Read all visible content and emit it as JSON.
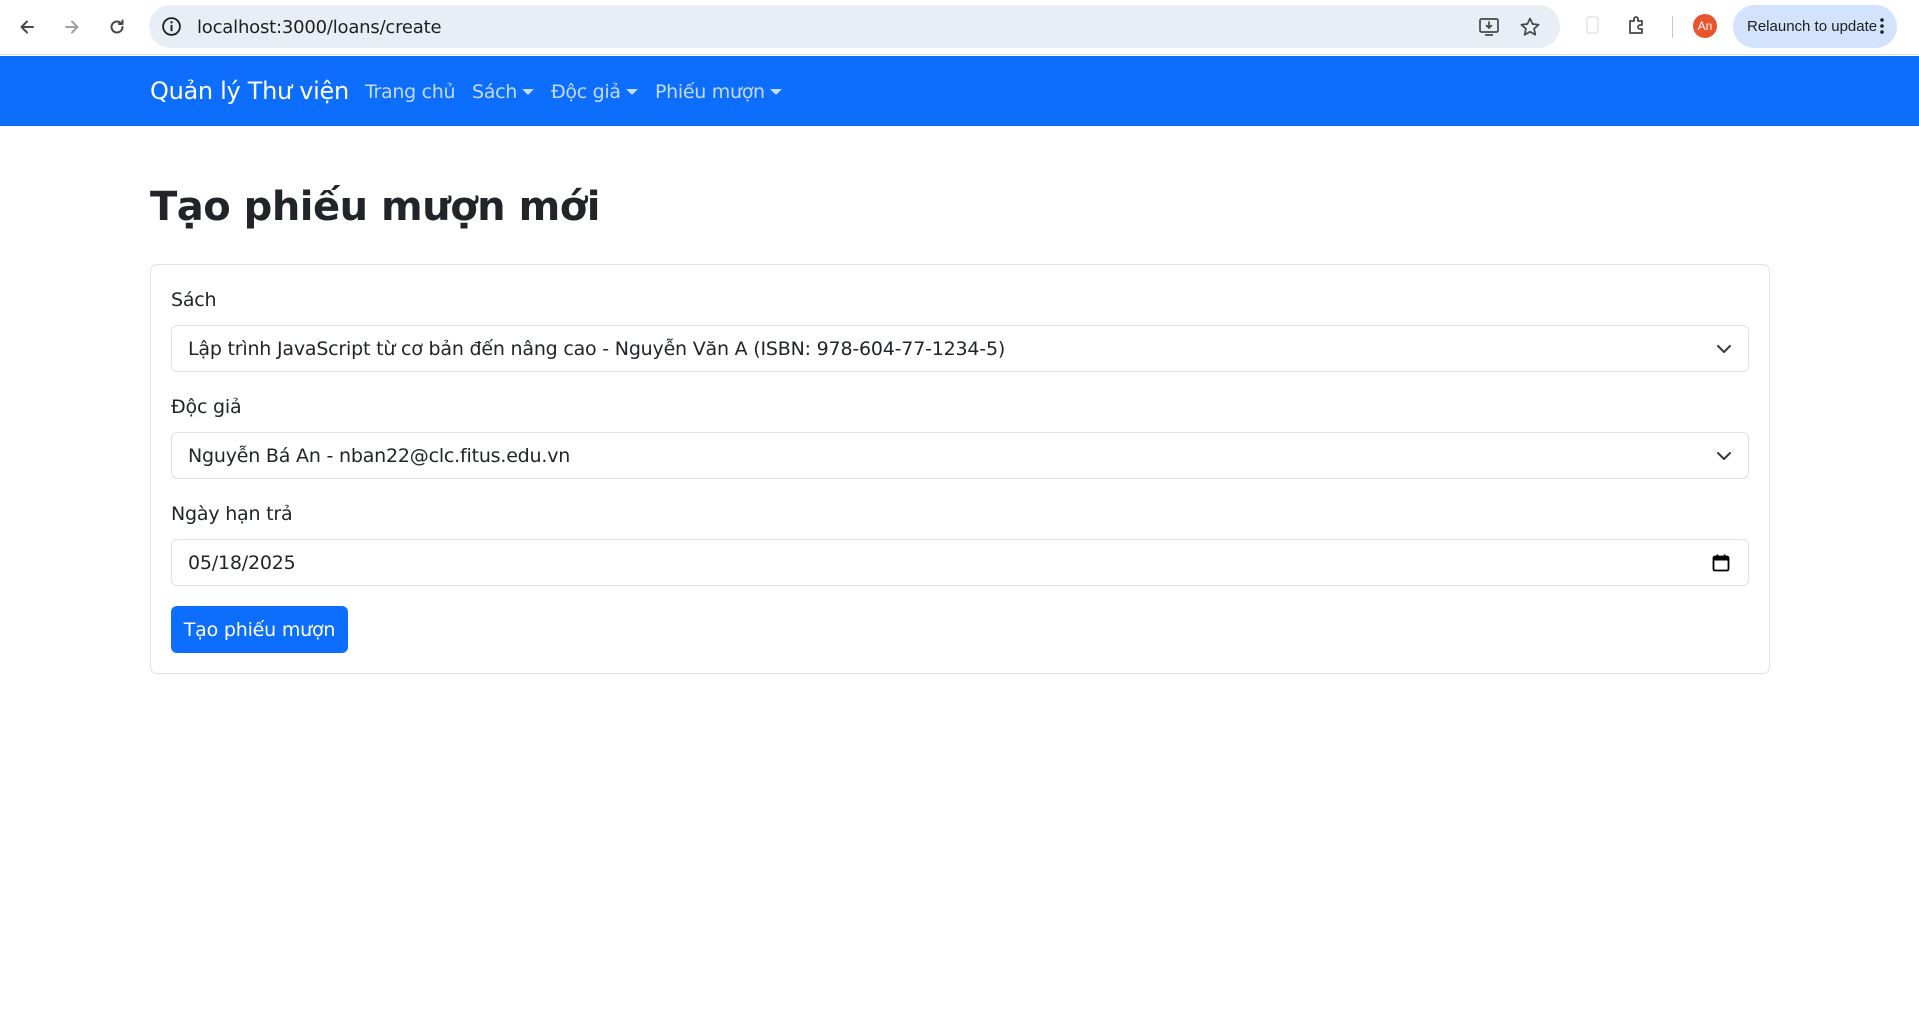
{
  "browser": {
    "url": "localhost:3000/loans/create",
    "avatar_initials": "An",
    "relaunch_label": "Relaunch to update"
  },
  "navbar": {
    "brand": "Quản lý Thư viện",
    "links": [
      {
        "label": "Trang chủ",
        "dropdown": false
      },
      {
        "label": "Sách",
        "dropdown": true
      },
      {
        "label": "Độc giả",
        "dropdown": true
      },
      {
        "label": "Phiếu mượn",
        "dropdown": true
      }
    ],
    "background": "#0d6efd"
  },
  "page": {
    "title": "Tạo phiếu mượn mới"
  },
  "form": {
    "book_label": "Sách",
    "book_value": "Lập trình JavaScript từ cơ bản đến nâng cao - Nguyễn Văn A (ISBN: 978-604-77-1234-5)",
    "reader_label": "Độc giả",
    "reader_value": "Nguyễn Bá An - nban22@clc.fitus.edu.vn",
    "due_label": "Ngày hạn trả",
    "due_value": "05/18/2025",
    "submit_label": "Tạo phiếu mượn"
  },
  "colors": {
    "primary": "#0d6efd",
    "avatar": "#e8542b",
    "relaunch_bg": "#d3e3fd"
  }
}
